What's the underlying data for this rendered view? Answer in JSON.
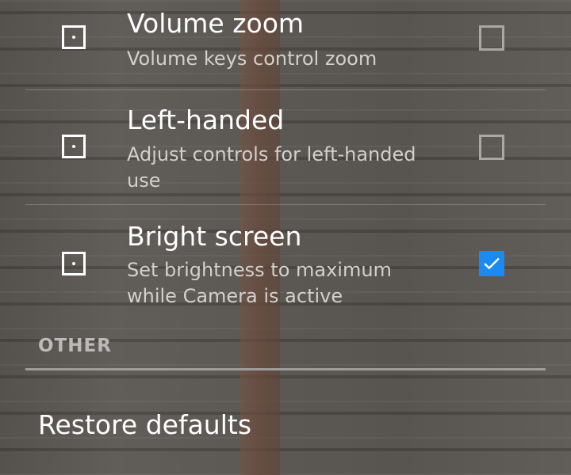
{
  "settings": [
    {
      "title": "Volume zoom",
      "summary": "Volume keys control zoom",
      "checked": false
    },
    {
      "title": "Left-handed",
      "summary": "Adjust controls for left-handed use",
      "checked": false
    },
    {
      "title": "Bright screen",
      "summary": "Set brightness to maximum while Camera is active",
      "checked": true
    }
  ],
  "other": {
    "header": "OTHER",
    "restore_label": "Restore defaults"
  },
  "icons": {
    "setting_icon": "focus-square-icon",
    "check_icon": "checkmark-icon"
  },
  "colors": {
    "checkbox_checked": "#1a8bf2",
    "text_primary": "#ffffff",
    "text_secondary": "#d2d0cd"
  }
}
